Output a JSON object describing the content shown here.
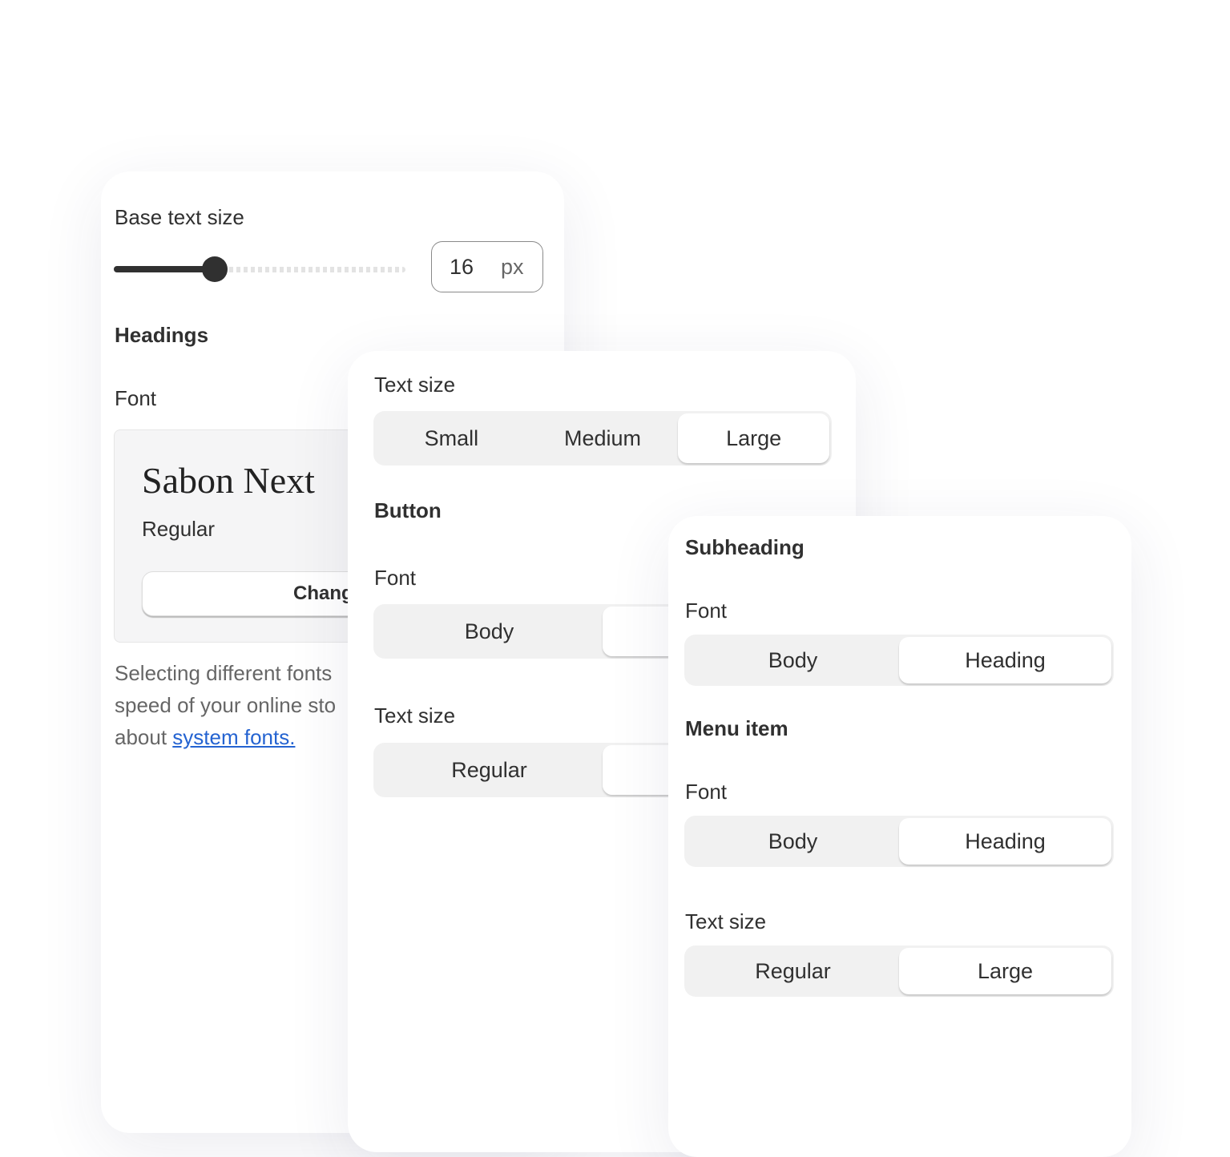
{
  "base_panel": {
    "title": "Base text size",
    "slider_value_fraction": 0.35,
    "size_value": "16",
    "size_unit": "px",
    "headings_title": "Headings",
    "font_label": "Font",
    "font_name": "Sabon Next",
    "font_style": "Regular",
    "change_button": "Chang",
    "help_line1": "Selecting different fonts",
    "help_line2": "speed of your online sto",
    "help_line3_prefix": "about ",
    "help_link": "system fonts.",
    "link_color": "#2463d1"
  },
  "button_panel": {
    "text_size_label": "Text size",
    "text_size_options": [
      "Small",
      "Medium",
      "Large"
    ],
    "text_size_selected": "Large",
    "button_title": "Button",
    "font_label": "Font",
    "font_options": [
      "Body"
    ],
    "text_size_label2": "Text size",
    "text_size_options2": [
      "Regular"
    ]
  },
  "sub_panel": {
    "subheading_title": "Subheading",
    "font_label": "Font",
    "font_options": [
      "Body",
      "Heading"
    ],
    "menu_title": "Menu item",
    "menu_font_label": "Font",
    "menu_font_options": [
      "Body",
      "Heading"
    ],
    "text_size_label": "Text size",
    "text_size_options": [
      "Regular",
      "Large"
    ]
  }
}
